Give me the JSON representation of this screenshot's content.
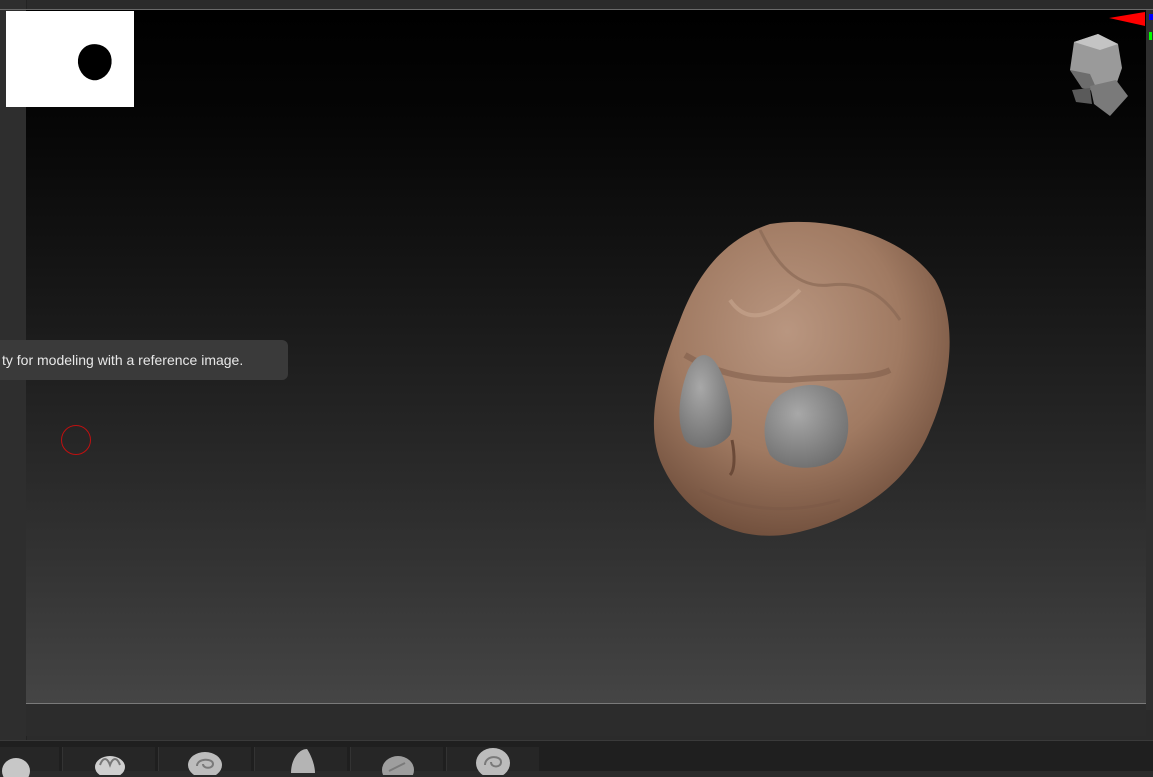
{
  "tooltip": {
    "text": "ty for modeling with a reference image."
  },
  "viewport": {
    "background_top": "#000000",
    "background_bottom": "#454545"
  },
  "model": {
    "icon": "skull-head-model",
    "skin_color": "#a07a62",
    "eye_color": "#8a8a8a"
  },
  "alpha": {
    "icon": "alpha-brush-thumbnail"
  },
  "navigator": {
    "icon": "navigation-head-icon"
  },
  "axis": {
    "x_color": "#ff0000",
    "y_color": "#00ff00",
    "z_color": "#0000ff"
  },
  "brushes": [
    {
      "icon": "standard-brush-icon"
    },
    {
      "icon": "clay-brush-icon"
    },
    {
      "icon": "move-brush-icon"
    },
    {
      "icon": "dam-standard-brush-icon"
    },
    {
      "icon": "inflate-brush-icon"
    },
    {
      "icon": "pinch-brush-icon"
    }
  ]
}
